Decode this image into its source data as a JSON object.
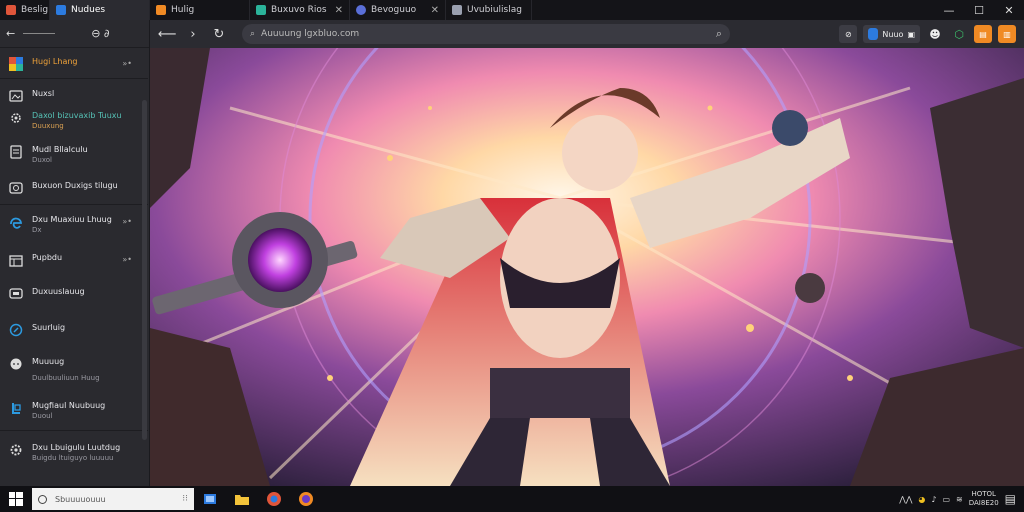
{
  "tabs": [
    {
      "label": "Beslig",
      "color": "#e0553a"
    },
    {
      "label": "Nudues",
      "color": "#2c7be0"
    },
    {
      "label": "Hulig",
      "color": "#f08a24"
    },
    {
      "label": "Buxuvo Rios",
      "color": "#2bb39a"
    },
    {
      "label": "Bevoguuo",
      "color": "#5a6fd8"
    },
    {
      "label": "Uvubiulislag",
      "color": "#9aa0b0"
    }
  ],
  "sidebar": {
    "header": {
      "back": "←",
      "label": "⊖ ∂"
    },
    "items": [
      {
        "label": "Hugi Lhang",
        "sub": "",
        "chev": "»•",
        "icon": "colorful-app-icon"
      },
      {
        "label": "Nuxsl",
        "sub": "",
        "chev": "",
        "icon": "image-icon"
      },
      {
        "label": "Daxol bizuvaxib Tuuxu",
        "sub": "Duuxung",
        "chev": "",
        "icon": "gear-icon"
      },
      {
        "label": "Mudl Bllalculu",
        "sub": "Duxol",
        "chev": "",
        "icon": "document-icon"
      },
      {
        "label": "Buxuon Duxigs tilugu",
        "sub": "",
        "chev": "»•",
        "icon": "photo-icon"
      },
      {
        "label": "Dxu Muaxiuu Lhuug",
        "sub": "Dx",
        "chev": "»•",
        "icon": "edge-icon"
      },
      {
        "label": "Pupbdu",
        "sub": "",
        "chev": "»•",
        "icon": "store-icon"
      },
      {
        "label": "Duxuuslauug",
        "sub": "",
        "chev": "",
        "icon": "monitor-icon"
      },
      {
        "label": "Suurluig",
        "sub": "",
        "chev": "",
        "icon": "compass-icon"
      },
      {
        "label": "Muuuug",
        "sub": "Duulbuuliuun Huug",
        "chev": "",
        "icon": "chat-icon"
      },
      {
        "label": "Mugfiaul Nuubuug",
        "sub": "Duoul",
        "chev": "",
        "icon": "blue-app-icon"
      },
      {
        "label": "Dxu Lbuigulu Luutdug",
        "sub": "Buigdu ltuiguyo luuuuu",
        "chev": "",
        "icon": "settings-icon"
      }
    ]
  },
  "toolbar": {
    "url": "Auuuung lgxbluo.com",
    "right_label": "Nuuo",
    "zoom_label": "⊘"
  },
  "taskbar": {
    "search_placeholder": "Sbuuuuouuu",
    "time": "HOTOL",
    "date": "DAI8E20"
  },
  "colors": {
    "accent": "#f08a24",
    "bg": "#1e1e22",
    "sidebar": "#2a2a2f"
  }
}
